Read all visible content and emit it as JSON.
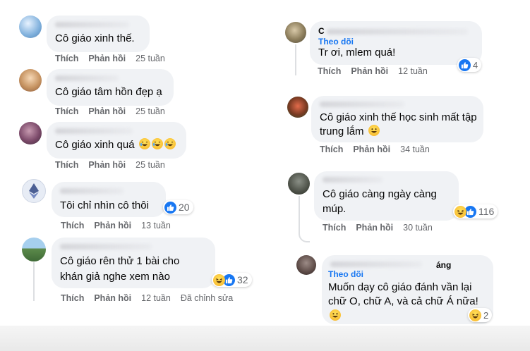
{
  "left_comments": [
    {
      "text": "Cô giáo xinh thế.",
      "actions": [
        "Thích",
        "Phản hồi"
      ],
      "time": "25 tuần"
    },
    {
      "text": "Cô giáo tâm hồn đẹp ạ",
      "actions": [
        "Thích",
        "Phản hồi"
      ],
      "time": "25 tuần"
    },
    {
      "text": "Cô giáo xinh quá",
      "actions": [
        "Thích",
        "Phản hồi"
      ],
      "time": "25 tuần",
      "emoji": [
        "rofl",
        "rofl",
        "rofl"
      ]
    },
    {
      "text": "Tôi chỉ nhìn cô thôi",
      "actions": [
        "Thích",
        "Phản hồi"
      ],
      "time": "13 tuần",
      "reaction_count": "20",
      "reactions": [
        "like"
      ]
    },
    {
      "text_lines": [
        "Cô giáo rên thử 1 bài cho",
        "khán giả nghe xem nào"
      ],
      "actions": [
        "Thích",
        "Phản hồi"
      ],
      "time": "12 tuần",
      "edited": "Đã chỉnh sửa",
      "reaction_count": "32",
      "reactions": [
        "haha",
        "like"
      ]
    }
  ],
  "right_comments": [
    {
      "name_fragment": "C",
      "follow": "Theo dõi",
      "text": "Tr ơi, mlem quá!",
      "actions": [
        "Thích",
        "Phản hồi"
      ],
      "time": "12 tuần",
      "reaction_count": "4",
      "reactions": [
        "like"
      ]
    },
    {
      "text_lines": [
        "Cô giáo xinh thế học sinh mất tập",
        "trung lắm"
      ],
      "emoji": [
        "grin"
      ],
      "actions": [
        "Thích",
        "Phản hồi"
      ],
      "time": "34 tuần"
    },
    {
      "text_lines": [
        "Cô giáo càng ngày càng",
        "múp."
      ],
      "actions": [
        "Thích",
        "Phản hồi"
      ],
      "time": "30 tuần",
      "reaction_count": "116",
      "reactions": [
        "haha",
        "like"
      ]
    },
    {
      "name_fragment": "áng",
      "follow": "Theo dõi",
      "text_lines": [
        "Muốn dạy cô giáo đánh vần lại",
        "chữ O, chữ A, và cả chữ Á nữa!"
      ],
      "emoji": [
        "grin"
      ],
      "reaction_count": "2",
      "reactions": [
        "haha"
      ]
    }
  ],
  "colors": {
    "bubble": "#f0f2f5",
    "meta": "#65676b",
    "link": "#1877f2",
    "like": "#1877f2",
    "haha": "#f7b125"
  }
}
